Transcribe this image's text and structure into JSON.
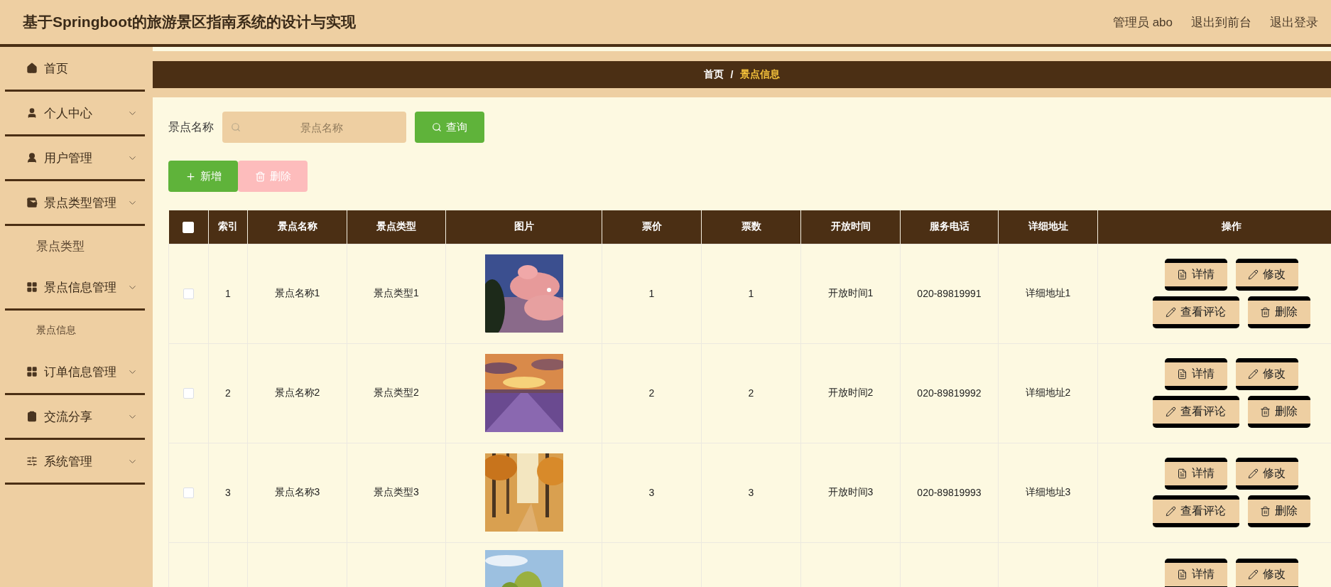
{
  "header": {
    "title": "基于Springboot的旅游景区指南系统的设计与实现",
    "user": "管理员 abo",
    "links": [
      "退出到前台",
      "退出登录"
    ]
  },
  "sidebar": {
    "items": [
      {
        "label": "首页",
        "kind": "link"
      },
      {
        "label": "个人中心",
        "kind": "group"
      },
      {
        "label": "用户管理",
        "kind": "group"
      },
      {
        "label": "景点类型管理",
        "kind": "group",
        "expanded": true,
        "children": [
          {
            "label": "景点类型"
          }
        ]
      },
      {
        "label": "景点信息管理",
        "kind": "group",
        "expanded": true,
        "children": [
          {
            "label": "景点信息"
          }
        ]
      },
      {
        "label": "订单信息管理",
        "kind": "group"
      },
      {
        "label": "交流分享",
        "kind": "group"
      },
      {
        "label": "系统管理",
        "kind": "group"
      }
    ]
  },
  "breadcrumb": {
    "separator": "/",
    "items": [
      {
        "label": "首页",
        "current": false
      },
      {
        "label": "景点信息",
        "current": true
      }
    ]
  },
  "search": {
    "label": "景点名称",
    "placeholder": "景点名称",
    "button": "查询"
  },
  "actions": [
    {
      "label": "新增",
      "kind": "add"
    },
    {
      "label": "删除",
      "kind": "delete",
      "disabled": true
    }
  ],
  "table": {
    "header_checked": false,
    "columns": [
      "索引",
      "景点名称",
      "景点类型",
      "图片",
      "票价",
      "票数",
      "开放时间",
      "服务电话",
      "详细地址",
      "操作"
    ],
    "rows": [
      {
        "checked": false,
        "cells": [
          "1",
          "景点名称1",
          "景点类型1"
        ],
        "image": {
          "kind": "picture"
        },
        "cells_after": [
          "1",
          "1",
          "开放时间1",
          "020-89819991",
          "详细地址1"
        ],
        "actions": [
          {
            "label": "详情",
            "kind": "detail"
          },
          {
            "label": "修改",
            "kind": "edit"
          },
          {
            "label": "查看评论",
            "kind": "comment"
          },
          {
            "label": "删除",
            "kind": "delete"
          }
        ]
      },
      {
        "checked": false,
        "cells": [
          "2",
          "景点名称2",
          "景点类型2"
        ],
        "image": {
          "kind": "picture"
        },
        "cells_after": [
          "2",
          "2",
          "开放时间2",
          "020-89819992",
          "详细地址2"
        ],
        "actions": [
          {
            "label": "详情",
            "kind": "detail"
          },
          {
            "label": "修改",
            "kind": "edit"
          },
          {
            "label": "查看评论",
            "kind": "comment"
          },
          {
            "label": "删除",
            "kind": "delete"
          }
        ]
      },
      {
        "checked": false,
        "cells": [
          "3",
          "景点名称3",
          "景点类型3"
        ],
        "image": {
          "kind": "picture"
        },
        "cells_after": [
          "3",
          "3",
          "开放时间3",
          "020-89819993",
          "详细地址3"
        ],
        "actions": [
          {
            "label": "详情",
            "kind": "detail"
          },
          {
            "label": "修改",
            "kind": "edit"
          },
          {
            "label": "查看评论",
            "kind": "comment"
          },
          {
            "label": "删除",
            "kind": "delete"
          }
        ]
      },
      {
        "image": {
          "kind": "picture"
        },
        "actions": [
          {
            "label": "详情",
            "kind": "detail"
          },
          {
            "label": "修改",
            "kind": "edit"
          }
        ]
      }
    ]
  }
}
